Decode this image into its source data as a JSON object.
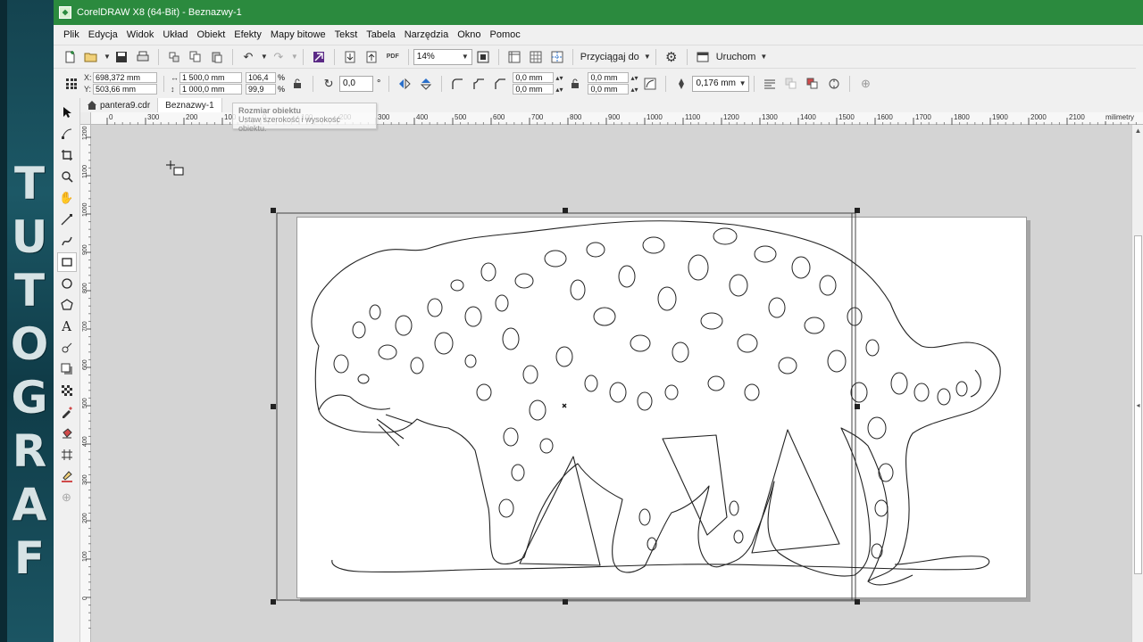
{
  "banner": {
    "letters": [
      "T",
      "U",
      "T",
      "O",
      "G",
      "R",
      "A",
      "F"
    ]
  },
  "window": {
    "title": "CorelDRAW X8 (64-Bit) - Beznazwy-1"
  },
  "menu": [
    "Plik",
    "Edycja",
    "Widok",
    "Układ",
    "Obiekt",
    "Efekty",
    "Mapy bitowe",
    "Tekst",
    "Tabela",
    "Narzędzia",
    "Okno",
    "Pomoc"
  ],
  "toolbar1": {
    "zoom": "14%",
    "snap_label": "Przyciągaj do",
    "launch_label": "Uruchom",
    "pdf_label": "PDF"
  },
  "props": {
    "x": "698,372 mm",
    "y": "503,66 mm",
    "x_label": "X:",
    "y_label": "Y:",
    "width": "1 500,0 mm",
    "height": "1 000,0 mm",
    "scale_w": "106,4",
    "scale_h": "99,9",
    "pct": "%",
    "rotation": "0,0",
    "degree": "°",
    "corner1": "0,0 mm",
    "corner2": "0,0 mm",
    "corner3": "0,0 mm",
    "corner4": "0,0 mm",
    "outline": "0,176 mm"
  },
  "tabs": {
    "welcome": "pantera9.cdr",
    "document": "Beznazwy-1"
  },
  "tooltip": {
    "title": "Rozmiar obiektu",
    "text": "Ustaw szerokość i wysokość obiektu."
  },
  "ruler": {
    "h_ticks": [
      "0",
      "300",
      "200",
      "100",
      "0",
      "100",
      "200",
      "300",
      "400",
      "500",
      "600",
      "700",
      "800",
      "900",
      "1000",
      "1100",
      "1200",
      "1300",
      "1400",
      "1500",
      "1600",
      "1700",
      "1800",
      "1900",
      "2000",
      "2100",
      "2200"
    ],
    "h_unit": "milimetry",
    "v_ticks": [
      "1200",
      "1100",
      "1000",
      "900",
      "800",
      "700",
      "600",
      "500",
      "400",
      "300",
      "200",
      "100",
      "0"
    ]
  }
}
